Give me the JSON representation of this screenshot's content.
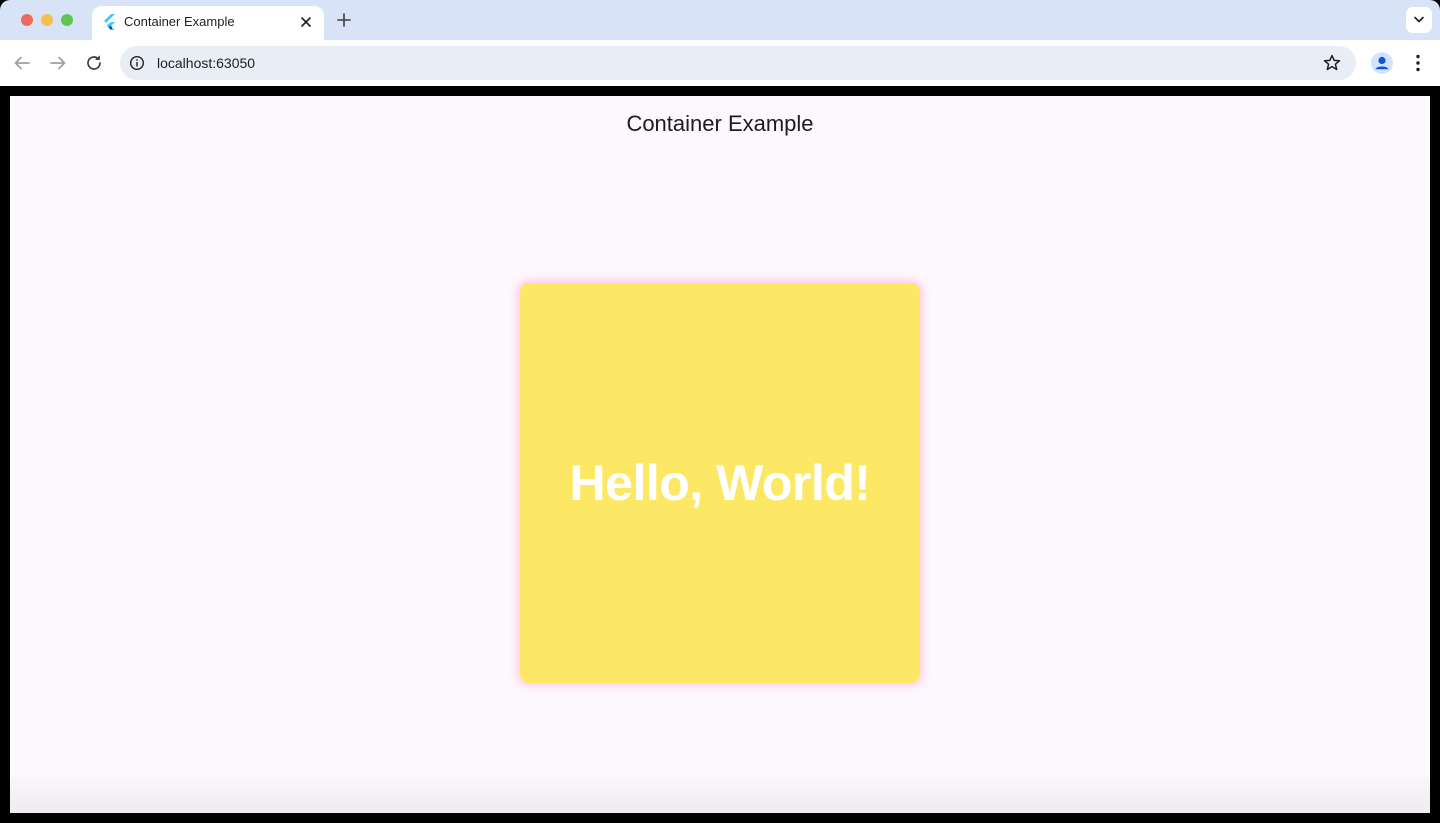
{
  "browser": {
    "tab": {
      "title": "Container Example",
      "favicon": "flutter-icon",
      "close_icon": "close-icon"
    },
    "new_tab_icon": "plus-icon",
    "tab_search_icon": "chevron-down-icon",
    "nav": {
      "back_icon": "arrow-left-icon",
      "forward_icon": "arrow-right-icon",
      "reload_icon": "reload-icon"
    },
    "omnibox": {
      "info_icon": "info-icon",
      "url": "localhost:63050",
      "bookmark_icon": "star-icon"
    },
    "profile_icon": "profile-icon",
    "menu_icon": "kebab-menu-icon"
  },
  "page": {
    "title": "Container Example",
    "card": {
      "text": "Hello, World!",
      "background_color": "#fde865",
      "text_color": "#ffffff",
      "shadow_color": "#ffaad2"
    },
    "background_color": "#fcf8fd"
  }
}
